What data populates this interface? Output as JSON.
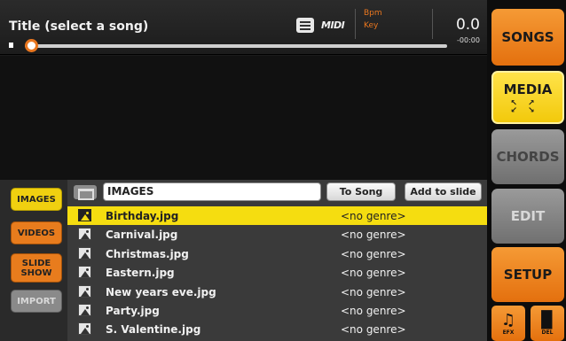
{
  "player": {
    "title": "Title (select a song)",
    "midi_label": "MIDI",
    "bpm_label": "Bpm",
    "key_label": "Key",
    "time": "0.0",
    "time_remaining": "-00:00",
    "progress": 0
  },
  "categories": {
    "images": "IMAGES",
    "videos": "VIDEOS",
    "slide_show_line1": "SLIDE",
    "slide_show_line2": "SHOW",
    "import": "IMPORT"
  },
  "browser": {
    "path": "IMAGES",
    "to_song_label": "To Song",
    "add_to_slide_label": "Add to slide",
    "files": [
      {
        "name": "Birthday.jpg",
        "genre": "<no genre>",
        "selected": true
      },
      {
        "name": "Carnival.jpg",
        "genre": "<no genre>",
        "selected": false
      },
      {
        "name": "Christmas.jpg",
        "genre": "<no genre>",
        "selected": false
      },
      {
        "name": "Eastern.jpg",
        "genre": "<no genre>",
        "selected": false
      },
      {
        "name": "New years eve.jpg",
        "genre": "<no genre>",
        "selected": false
      },
      {
        "name": "Party.jpg",
        "genre": "<no genre>",
        "selected": false
      },
      {
        "name": "S. Valentine.jpg",
        "genre": "<no genre>",
        "selected": false
      }
    ]
  },
  "nav": {
    "songs": "SONGS",
    "media": "MEDIA",
    "chords": "CHORDS",
    "edit": "EDIT",
    "setup": "SETUP",
    "efx": "EFX",
    "del": "DEL"
  },
  "colors": {
    "accent_orange": "#e87c1d",
    "accent_yellow": "#f5dd10",
    "disabled_gray": "#8a8a8a"
  },
  "icons": {
    "playlist": "list-icon",
    "folder": "folder-icon",
    "file": "image-file-icon",
    "efx": "magic-wand-icon",
    "del": "trash-icon",
    "media_expand": "expand-arrows-icon"
  }
}
